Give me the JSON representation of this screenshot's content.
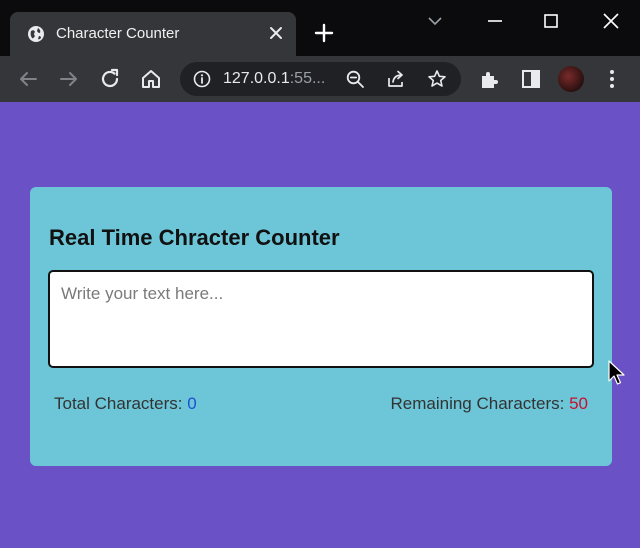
{
  "browser": {
    "tab_title": "Character Counter",
    "url_host": "127.0.0.1",
    "url_rest": ":55...",
    "icons": {
      "tab": "globe-icon",
      "close": "close-icon",
      "new_tab": "plus-icon",
      "back": "arrow-left-icon",
      "forward": "arrow-right-icon",
      "reload": "reload-icon",
      "home": "home-icon",
      "site_info": "info-icon",
      "zoom": "zoom-out-icon",
      "share": "share-icon",
      "bookmark": "star-icon",
      "extensions": "puzzle-icon",
      "side_panel": "side-panel-icon",
      "menu": "kebab-menu-icon"
    }
  },
  "app": {
    "title": "Real Time Chracter Counter",
    "textarea_placeholder": "Write your text here...",
    "total_label": "Total Characters: ",
    "total_value": "0",
    "remaining_label": "Remaining Characters: ",
    "remaining_value": "50"
  },
  "colors": {
    "page_bg": "#6a52c6",
    "card_bg": "#6cc6d8",
    "total_value": "#1f4ed6",
    "remaining_value": "#c8102e"
  }
}
